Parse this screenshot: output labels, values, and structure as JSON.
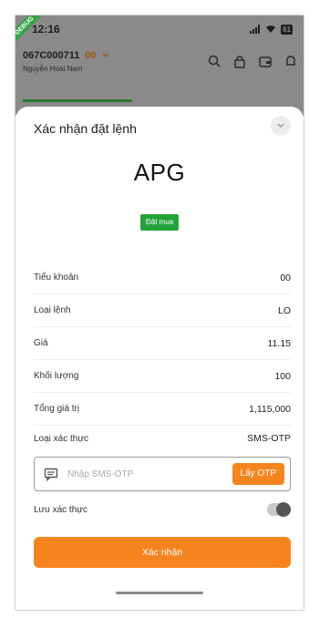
{
  "status_bar": {
    "time": "12:16",
    "debug_label": "DEBUG",
    "battery": "61"
  },
  "account": {
    "number": "067C000711",
    "sub_account": "00",
    "name": "Nguyễn Hoài Nam"
  },
  "sheet": {
    "title": "Xác nhận đặt lệnh",
    "symbol": "APG",
    "side_badge": "Đặt mua",
    "rows": [
      {
        "label": "Tiểu khoản",
        "value": "00"
      },
      {
        "label": "Loại lệnh",
        "value": "LO"
      },
      {
        "label": "Giá",
        "value": "11.15"
      },
      {
        "label": "Khối lượng",
        "value": "100"
      },
      {
        "label": "Tổng giá trị",
        "value": "1,115,000"
      },
      {
        "label": "Loại xác thực",
        "value": "SMS-OTP"
      }
    ],
    "otp": {
      "placeholder": "Nhập SMS-OTP",
      "value": "",
      "get_button": "Lấy OTP"
    },
    "save_auth_label": "Lưu xác thực",
    "save_auth_on": false,
    "confirm_label": "Xác nhận"
  },
  "colors": {
    "accent": "#f5841f",
    "buy_green": "#22a33a",
    "overlay": "#8a8a8a"
  },
  "icons": [
    "search-icon",
    "lock-icon",
    "wallet-icon",
    "bell-icon",
    "close-icon",
    "message-icon",
    "signal-icon",
    "wifi-icon"
  ]
}
